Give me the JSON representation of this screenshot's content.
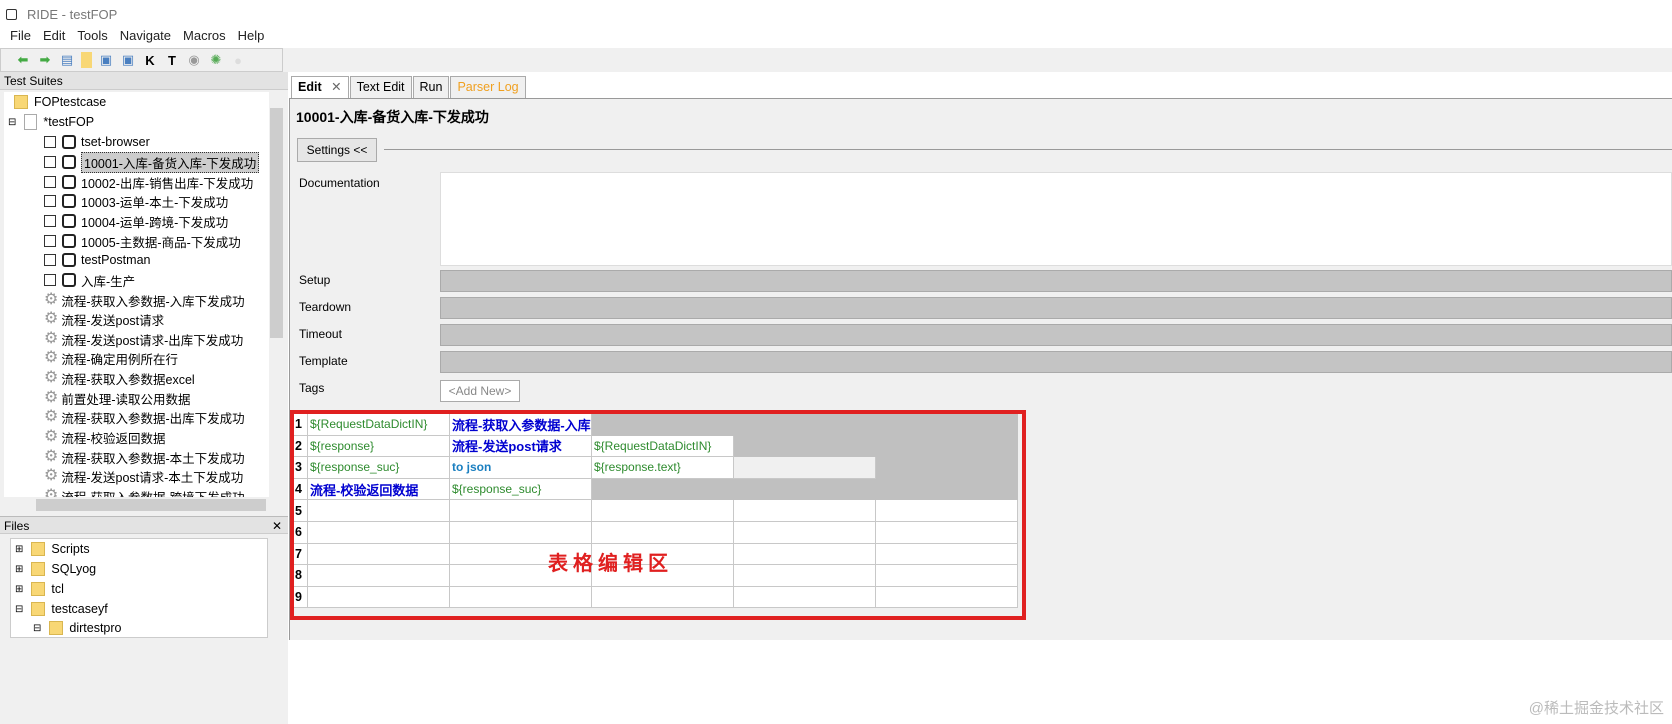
{
  "window": {
    "title": "RIDE - testFOP"
  },
  "menu": [
    "File",
    "Edit",
    "Tools",
    "Navigate",
    "Macros",
    "Help"
  ],
  "toolbar": {
    "icons": [
      "back-arrow-icon",
      "forward-arrow-icon",
      "open-folder-icon",
      "folder-icon",
      "save-icon",
      "save-all-icon",
      "search-keyword-icon",
      "search-test-icon",
      "run-icon",
      "debug-bug-icon",
      "stop-icon"
    ],
    "k": "K",
    "t": "T"
  },
  "test_suites": {
    "header": "Test Suites",
    "root": "FOPtestcase",
    "suite": "*testFOP",
    "tests": [
      "tset-browser",
      "10001-入库-备货入库-下发成功",
      "10002-出库-销售出库-下发成功",
      "10003-运单-本土-下发成功",
      "10004-运单-跨境-下发成功",
      "10005-主数据-商品-下发成功",
      "testPostman",
      "入库-生产"
    ],
    "selected_test": "10001-入库-备货入库-下发成功",
    "keywords": [
      "流程-获取入参数据-入库下发成功",
      "流程-发送post请求",
      "流程-发送post请求-出库下发成功",
      "流程-确定用例所在行",
      "流程-获取入参数据excel",
      "前置处理-读取公用数据",
      "流程-获取入参数据-出库下发成功",
      "流程-校验返回数据",
      "流程-获取入参数据-本土下发成功",
      "流程-发送post请求-本土下发成功",
      "流程-获取入参数据-跨境下发成功"
    ]
  },
  "files": {
    "header": "Files",
    "close": "✕",
    "items": [
      "Scripts",
      "SQLyog",
      "tcl",
      "testcaseyf",
      "dirtestpro"
    ]
  },
  "tabs": [
    {
      "label": "Edit",
      "close": "✕"
    },
    {
      "label": "Text Edit"
    },
    {
      "label": "Run"
    },
    {
      "label": "Parser Log"
    }
  ],
  "editor": {
    "title": "10001-入库-备货入库-下发成功",
    "settings_button": "Settings <<",
    "fields": {
      "documentation": "Documentation",
      "setup": "Setup",
      "teardown": "Teardown",
      "timeout": "Timeout",
      "template": "Template",
      "tags": "Tags"
    },
    "add_new": "<Add New>",
    "grid": {
      "rows": [
        [
          "${RequestDataDictIN}",
          "流程-获取入参数据-入库",
          "",
          "",
          ""
        ],
        [
          "${response}",
          "流程-发送post请求",
          "${RequestDataDictIN}",
          "",
          ""
        ],
        [
          "${response_suc}",
          "to json",
          "${response.text}",
          "",
          ""
        ],
        [
          "流程-校验返回数据",
          "${response_suc}",
          "",
          "",
          ""
        ],
        [
          "",
          "",
          "",
          "",
          ""
        ],
        [
          "",
          "",
          "",
          "",
          ""
        ],
        [
          "",
          "",
          "",
          "",
          ""
        ],
        [
          "",
          "",
          "",
          "",
          ""
        ],
        [
          "",
          "",
          "",
          "",
          ""
        ]
      ]
    },
    "annotation": "表格编辑区"
  },
  "watermark": "@稀土掘金技术社区",
  "colors": {
    "annotation_red": "#e02020",
    "keyword_blue": "#0000d0",
    "variable_green": "#2e8b2e"
  }
}
